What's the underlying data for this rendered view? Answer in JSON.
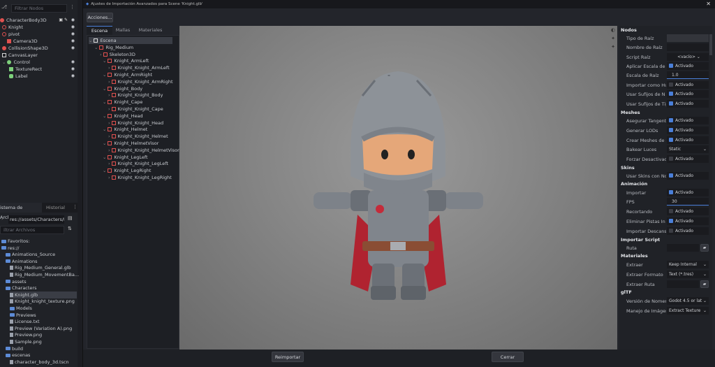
{
  "scene_dock": {
    "filter_placeholder": "Filtrar Nodos",
    "nodes": [
      {
        "label": "CharacterBody3D",
        "color": "#e0514f"
      },
      {
        "label": "Knight",
        "color": "#e0514f"
      },
      {
        "label": "pivot",
        "color": "#e0514f"
      },
      {
        "label": "Camera3D",
        "color": "#e0514f"
      },
      {
        "label": "CollisionShape3D",
        "color": "#e0514f"
      },
      {
        "label": "CanvasLayer",
        "color": "#d6d6d6"
      },
      {
        "label": "Control",
        "color": "#7dd07b"
      },
      {
        "label": "TextureRect",
        "color": "#7dd07b"
      },
      {
        "label": "Label",
        "color": "#7dd07b"
      }
    ]
  },
  "filesystem": {
    "tab_files": "istema de Archivos",
    "tab_history": "Historial",
    "path": "res://assets/Characters/K",
    "filter_placeholder": "iltrar Archivos",
    "items": [
      {
        "label": "Favoritos:",
        "type": "folder"
      },
      {
        "label": "res://",
        "type": "folder"
      },
      {
        "label": "Animations_Source",
        "type": "folder"
      },
      {
        "label": "Animations",
        "type": "folder"
      },
      {
        "label": "Rig_Medium_General.glb",
        "type": "file"
      },
      {
        "label": "Rig_Medium_MovementBa...",
        "type": "file"
      },
      {
        "label": "assets",
        "type": "folder"
      },
      {
        "label": "Characters",
        "type": "folder"
      },
      {
        "label": "Knight.glb",
        "type": "file"
      },
      {
        "label": "Knight_knight_texture.png",
        "type": "file"
      },
      {
        "label": "Models",
        "type": "folder"
      },
      {
        "label": "Previews",
        "type": "folder"
      },
      {
        "label": "License.txt",
        "type": "file"
      },
      {
        "label": "Preview (Variation A).png",
        "type": "file"
      },
      {
        "label": "Preview.png",
        "type": "file"
      },
      {
        "label": "Sample.png",
        "type": "file"
      },
      {
        "label": "build",
        "type": "folder"
      },
      {
        "label": "escenas",
        "type": "folder"
      },
      {
        "label": "character_body_3d.tscn",
        "type": "file"
      }
    ]
  },
  "dialog": {
    "title": "Ajustes de Importación Avanzados para Scene 'Knight.glb'",
    "actions_button": "Acciones...",
    "tabs": [
      "Escena",
      "Mallas",
      "Materiales"
    ],
    "scene_tree": [
      "Escena",
      "Rig_Medium",
      "Skeleton3D",
      "Knight_ArmLeft",
      "Knight_Knight_ArmLeft",
      "Knight_ArmRight",
      "Knight_Knight_ArmRight",
      "Knight_Body",
      "Knight_Knight_Body",
      "Knight_Cape",
      "Knight_Knight_Cape",
      "Knight_Head",
      "Knight_Knight_Head",
      "Knight_Helmet",
      "Knight_Knight_Helmet",
      "Knight_HelmetVisor",
      "Knight_Knight_HelmetVisor",
      "Knight_LegLeft",
      "Knight_Knight_LegLeft",
      "Knight_LegRight",
      "Knight_Knight_LegRight"
    ],
    "reimport_button": "Reimportar",
    "close_button": "Cerrar"
  },
  "inspector": {
    "sections": {
      "nodos": "Nodos",
      "meshes": "Meshes",
      "skins": "Skins",
      "animacion": "Animación",
      "importar_script": "Importar Script",
      "materiales": "Materiales",
      "gltf": "glTF"
    },
    "labels": {
      "tipo_raiz": "Tipo de Raíz",
      "nombre_raiz": "Nombre de Raíz",
      "script_raiz": "Script Raíz",
      "aplicar_escala": "Aplicar Escala de",
      "escala_raiz": "Escala de Raíz",
      "importar_como": "Importar como Hu",
      "usar_sufijos_nombre": "Usar Sufijos de N",
      "usar_sufijos_tipo": "Usar Sufijos de Tip",
      "asegurar_tangentes": "Asegurar Tangente",
      "generar_lods": "Generar LODs",
      "crear_meshes": "Crear Meshes de S",
      "bakear_luces": "Bakear Luces",
      "forzar_desactivacion": "Forzar Desactivaci",
      "usar_skins": "Usar Skins con No",
      "importar": "Importar",
      "fps": "FPS",
      "recortando": "Recortando",
      "eliminar_pistas": "Eliminar Pistas In",
      "importar_descans": "Importar Descans",
      "ruta": "Ruta",
      "extraer": "Extraer",
      "extraer_formato": "Extraer Formato",
      "extraer_ruta": "Extraer Ruta",
      "version_nomen": "Versión de Nomen",
      "manejo_imagen": "Manejo de Imágen"
    },
    "values": {
      "script_raiz": "<vacío>",
      "activado": "Activado",
      "desactivado": "Activado",
      "escala_raiz": "1.0",
      "bakear_luces": "Static",
      "fps": "30",
      "extraer": "Keep Internal",
      "extraer_formato": "Text (*.tres)",
      "version_nomen": "Godot 4.5 or lat",
      "manejo_imagen": "Extract Texture"
    }
  },
  "colors": {
    "accent": "#4a7fd9",
    "node3d": "#e0514f",
    "control": "#7dd07b"
  }
}
